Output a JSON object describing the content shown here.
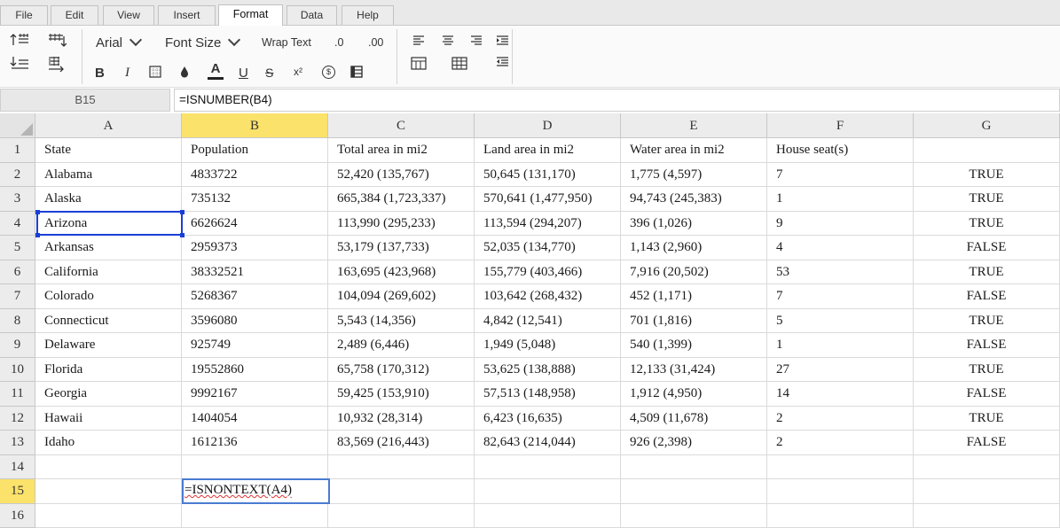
{
  "menu": {
    "tabs": [
      "File",
      "Edit",
      "View",
      "Insert",
      "Format",
      "Data",
      "Help"
    ],
    "active": "Format"
  },
  "toolbar": {
    "font_name": "Arial",
    "font_size_label": "Font Size",
    "wrap_text_label": "Wrap Text",
    "decrease_decimal_label": ".0",
    "increase_decimal_label": ".00",
    "icons": [
      "insert-row-above-icon",
      "insert-column-icon",
      "indent-rows-icon",
      "delete-rows-icon",
      "bold-icon",
      "italic-icon",
      "borders-icon",
      "fill-color-icon",
      "text-color-icon",
      "underline-icon",
      "strikethrough-icon",
      "superscript-icon",
      "currency-icon",
      "format-table-icon",
      "align-left-icon",
      "align-center-icon",
      "align-right-icon",
      "indent-icon",
      "merge-cells-icon",
      "table-icon",
      "outdent-icon"
    ],
    "bold": "B",
    "italic": "I",
    "text_color": "A",
    "underline": "U",
    "strike": "S",
    "superscript": "x²",
    "currency": "$",
    "accent_color": "#1a3fd6",
    "selected_header_color": "#fbe26a"
  },
  "formula_bar": {
    "cell_ref": "B15",
    "formula": "=ISNUMBER(B4)"
  },
  "sheet": {
    "columns": [
      "A",
      "B",
      "C",
      "D",
      "E",
      "F",
      "G"
    ],
    "selected_column": "B",
    "selected_row": 15,
    "rows": [
      {
        "n": "1",
        "cells": [
          "State",
          "Population",
          "Total area in mi2",
          "Land area in mi2",
          "Water area in mi2",
          "House seat(s)",
          ""
        ]
      },
      {
        "n": "2",
        "cells": [
          "Alabama",
          "4833722",
          "52,420 (135,767)",
          "50,645 (131,170)",
          "1,775 (4,597)",
          "7",
          "TRUE"
        ]
      },
      {
        "n": "3",
        "cells": [
          "Alaska",
          "735132",
          "665,384 (1,723,337)",
          "570,641 (1,477,950)",
          "94,743 (245,383)",
          "1",
          "TRUE"
        ]
      },
      {
        "n": "4",
        "cells": [
          "Arizona",
          "6626624",
          "113,990 (295,233)",
          "113,594 (294,207)",
          "396 (1,026)",
          "9",
          "TRUE"
        ]
      },
      {
        "n": "5",
        "cells": [
          "Arkansas",
          "2959373",
          "53,179 (137,733)",
          "52,035 (134,770)",
          "1,143 (2,960)",
          "4",
          "FALSE"
        ]
      },
      {
        "n": "6",
        "cells": [
          "California",
          "38332521",
          "163,695 (423,968)",
          "155,779 (403,466)",
          "7,916 (20,502)",
          "53",
          "TRUE"
        ]
      },
      {
        "n": "7",
        "cells": [
          "Colorado",
          "5268367",
          "104,094 (269,602)",
          "103,642 (268,432)",
          "452 (1,171)",
          "7",
          "FALSE"
        ]
      },
      {
        "n": "8",
        "cells": [
          "Connecticut",
          "3596080",
          "5,543 (14,356)",
          "4,842 (12,541)",
          "701 (1,816)",
          "5",
          "TRUE"
        ]
      },
      {
        "n": "9",
        "cells": [
          "Delaware",
          "925749",
          "2,489 (6,446)",
          "1,949 (5,048)",
          "540 (1,399)",
          "1",
          "FALSE"
        ]
      },
      {
        "n": "10",
        "cells": [
          "Florida",
          "19552860",
          "65,758 (170,312)",
          "53,625 (138,888)",
          "12,133 (31,424)",
          "27",
          "TRUE"
        ]
      },
      {
        "n": "11",
        "cells": [
          "Georgia",
          "9992167",
          "59,425 (153,910)",
          "57,513 (148,958)",
          "1,912 (4,950)",
          "14",
          "FALSE"
        ]
      },
      {
        "n": "12",
        "cells": [
          "Hawaii",
          "1404054",
          "10,932 (28,314)",
          "6,423 (16,635)",
          "4,509 (11,678)",
          "2",
          "TRUE"
        ]
      },
      {
        "n": "13",
        "cells": [
          "Idaho",
          "1612136",
          "83,569 (216,443)",
          "82,643 (214,044)",
          "926 (2,398)",
          "2",
          "FALSE"
        ]
      },
      {
        "n": "14",
        "cells": [
          "",
          "",
          "",
          "",
          "",
          "",
          ""
        ]
      },
      {
        "n": "15",
        "cells": [
          "",
          "",
          "",
          "",
          "",
          "",
          ""
        ]
      },
      {
        "n": "16",
        "cells": [
          "",
          "",
          "",
          "",
          "",
          "",
          ""
        ]
      }
    ],
    "editing_cell_text": "=ISNONTEXT(A4)"
  }
}
